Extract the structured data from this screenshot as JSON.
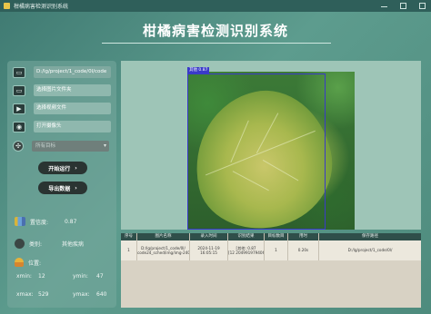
{
  "window": {
    "title": "柑橘病害检测识别系统"
  },
  "header": {
    "title": "柑橘病害检测识别系统"
  },
  "sidebar": {
    "path_value": "D:/lg/project/1_code/0l/code",
    "select_folder_label": "选择图片文件夹",
    "select_video_label": "选择视频文件",
    "open_camera_label": "打开摄像头",
    "target_select": {
      "selected": "所有目标",
      "caret": "▾"
    },
    "start_button": "开始运行",
    "export_button": "导出数据",
    "button_arrow": "›",
    "confidence": {
      "label": "置信度:",
      "value": "0.87"
    },
    "category": {
      "label": "类别:",
      "value": "其他疾病"
    },
    "position": {
      "label": "位置:",
      "xmin_label": "xmin:",
      "xmin": "12",
      "ymin_label": "ymin:",
      "ymin": "47",
      "xmax_label": "xmax:",
      "xmax": "529",
      "ymax_label": "ymax:",
      "ymax": "640"
    },
    "icons": {
      "path": "folder-icon",
      "folder": "folder-icon",
      "video": "video-icon",
      "camera": "camera-icon",
      "target": "target-icon",
      "confidence": "bar-chart-icon",
      "category": "category-icon",
      "position": "position-icon"
    }
  },
  "detection": {
    "tag": "其他 0.87",
    "box_color": "#3a3ac8"
  },
  "table": {
    "headers": [
      "序号",
      "图片名称",
      "录入时间",
      "识别结果",
      "目标数目",
      "用时",
      "保存路径"
    ],
    "rows": [
      {
        "index": "1",
        "image_name": [
          "D:/lg/project/1_code/0l/",
          "code24_sched/img/img-240.jpg"
        ],
        "time": [
          "2024-11-19",
          "16:05:15"
        ],
        "result": [
          "[其他: 0.87",
          "[12 20499197940677..."
        ],
        "count": "1",
        "duration": "0.20s",
        "save_path": "D:/lg/project/1_code/0l/"
      }
    ]
  },
  "colors": {
    "accent": "#2f4f4a",
    "panel": "#78aa9e"
  }
}
